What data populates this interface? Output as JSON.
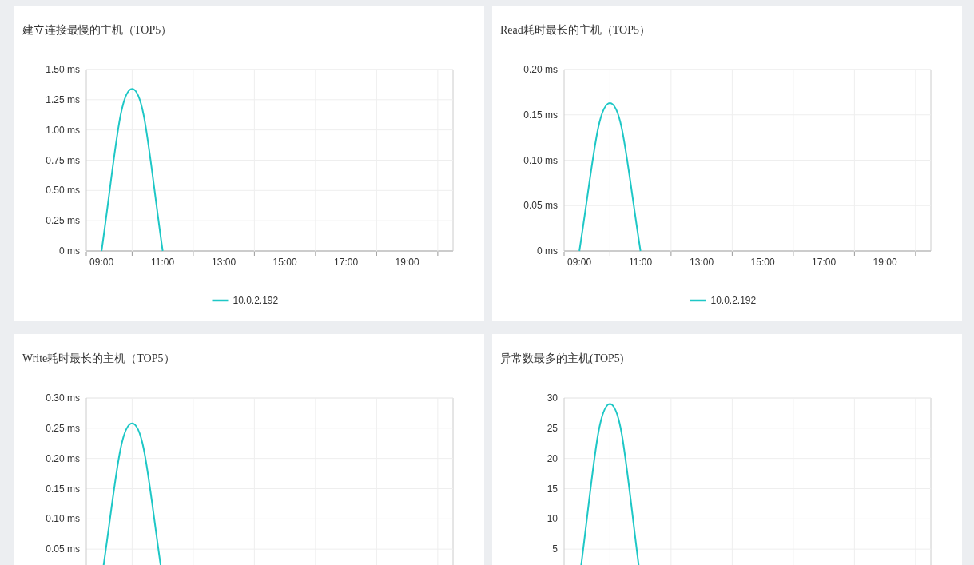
{
  "panels": [
    {
      "title": "建立连接最慢的主机（TOP5）",
      "chart_data": {
        "type": "line",
        "grid": true,
        "xlim": [
          8.5,
          20.5
        ],
        "xticks": [
          {
            "value": 9,
            "label": "09:00"
          },
          {
            "value": 11,
            "label": "11:00"
          },
          {
            "value": 13,
            "label": "13:00"
          },
          {
            "value": 15,
            "label": "15:00"
          },
          {
            "value": 17,
            "label": "17:00"
          },
          {
            "value": 19,
            "label": "19:00"
          }
        ],
        "ylim": [
          0,
          1.5
        ],
        "yticks": [
          {
            "value": 0,
            "label": "0 ms"
          },
          {
            "value": 0.25,
            "label": "0.25 ms"
          },
          {
            "value": 0.5,
            "label": "0.50 ms"
          },
          {
            "value": 0.75,
            "label": "0.75 ms"
          },
          {
            "value": 1,
            "label": "1.00 ms"
          },
          {
            "value": 1.25,
            "label": "1.25 ms"
          },
          {
            "value": 1.5,
            "label": "1.50 ms"
          }
        ],
        "x": [
          9,
          10,
          11
        ],
        "series": [
          {
            "name": "10.0.2.192",
            "color": "#1ec7c6",
            "values": [
              0,
              1.34,
              0
            ]
          }
        ]
      }
    },
    {
      "title": "Read耗时最长的主机（TOP5）",
      "chart_data": {
        "type": "line",
        "grid": true,
        "xlim": [
          8.5,
          20.5
        ],
        "xticks": [
          {
            "value": 9,
            "label": "09:00"
          },
          {
            "value": 11,
            "label": "11:00"
          },
          {
            "value": 13,
            "label": "13:00"
          },
          {
            "value": 15,
            "label": "15:00"
          },
          {
            "value": 17,
            "label": "17:00"
          },
          {
            "value": 19,
            "label": "19:00"
          }
        ],
        "ylim": [
          0,
          0.2
        ],
        "yticks": [
          {
            "value": 0,
            "label": "0 ms"
          },
          {
            "value": 0.05,
            "label": "0.05 ms"
          },
          {
            "value": 0.1,
            "label": "0.10 ms"
          },
          {
            "value": 0.15,
            "label": "0.15 ms"
          },
          {
            "value": 0.2,
            "label": "0.20 ms"
          }
        ],
        "x": [
          9,
          10,
          11
        ],
        "series": [
          {
            "name": "10.0.2.192",
            "color": "#1ec7c6",
            "values": [
              0,
              0.163,
              0
            ]
          }
        ]
      }
    },
    {
      "title": "Write耗时最长的主机（TOP5）",
      "chart_data": {
        "type": "line",
        "grid": true,
        "xlim": [
          8.5,
          20.5
        ],
        "ylim": [
          0,
          0.3
        ],
        "yticks": [
          {
            "value": 0.05,
            "label": "0.05 ms"
          },
          {
            "value": 0.1,
            "label": "0.10 ms"
          },
          {
            "value": 0.15,
            "label": "0.15 ms"
          },
          {
            "value": 0.2,
            "label": "0.20 ms"
          },
          {
            "value": 0.25,
            "label": "0.25 ms"
          },
          {
            "value": 0.3,
            "label": "0.30 ms"
          }
        ],
        "x": [
          9,
          10,
          11
        ],
        "series": [
          {
            "color": "#1ec7c6",
            "values": [
              0,
              0.258,
              0
            ]
          }
        ]
      }
    },
    {
      "title": "异常数最多的主机(TOP5)",
      "chart_data": {
        "type": "line",
        "grid": true,
        "xlim": [
          8.5,
          20.5
        ],
        "ylim": [
          0,
          30
        ],
        "yticks": [
          {
            "value": 5,
            "label": "5"
          },
          {
            "value": 10,
            "label": "10"
          },
          {
            "value": 15,
            "label": "15"
          },
          {
            "value": 20,
            "label": "20"
          },
          {
            "value": 25,
            "label": "25"
          },
          {
            "value": 30,
            "label": "30"
          }
        ],
        "x": [
          9,
          10,
          11
        ],
        "series": [
          {
            "color": "#1ec7c6",
            "values": [
              0,
              29,
              0
            ]
          }
        ]
      }
    }
  ]
}
